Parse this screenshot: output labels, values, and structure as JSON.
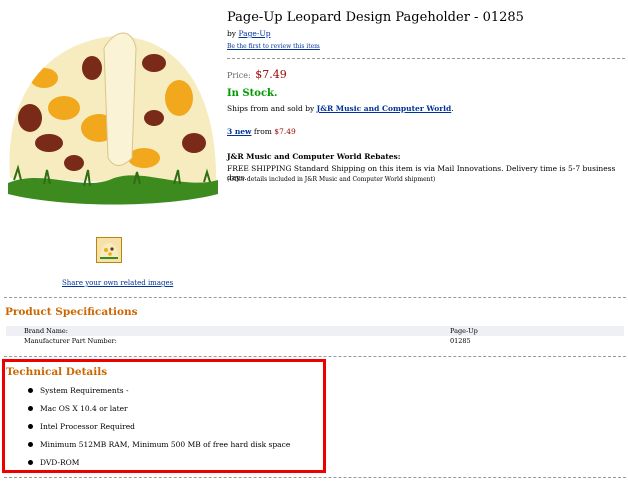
{
  "product": {
    "title": "Page-Up Leopard Design Pageholder - 01285",
    "by_label": "by",
    "brand_link": "Page-Up",
    "review_link": "Be the first to review this item",
    "price_label": "Price:",
    "price": "$7.49",
    "stock_status": "In Stock.",
    "ships_text": "Ships from and sold by",
    "seller": "J&R Music and Computer World",
    "new_count_link": "3 new",
    "new_from_text": "from",
    "new_from_price": "$7.49",
    "rebate_title": "J&R Music and Computer World Rebates:",
    "rebate_body": "FREE SHIPPING Standard Shipping on this item is via Mail Innovations. Delivery time is 5-7 business days.",
    "rebate_note": "(Offer details included in J&R Music and Computer World shipment)",
    "share_images_link": "Share your own related images"
  },
  "specs": {
    "heading": "Product Specifications",
    "rows": [
      {
        "label": "Brand Name:",
        "value": "Page-Up"
      },
      {
        "label": "Manufacturer Part Number:",
        "value": "01285"
      }
    ]
  },
  "tech": {
    "heading": "Technical Details",
    "items": [
      "System Requirements -",
      "Mac OS X 10.4 or later",
      "Intel Processor Required",
      "Minimum 512MB RAM, Minimum 500 MB of free hard disk space",
      "DVD-ROM"
    ]
  },
  "colors": {
    "link": "#003399",
    "price": "#990000",
    "in_stock": "#009900",
    "section_heading": "#cc6600",
    "highlight_box": "#ee0000"
  }
}
